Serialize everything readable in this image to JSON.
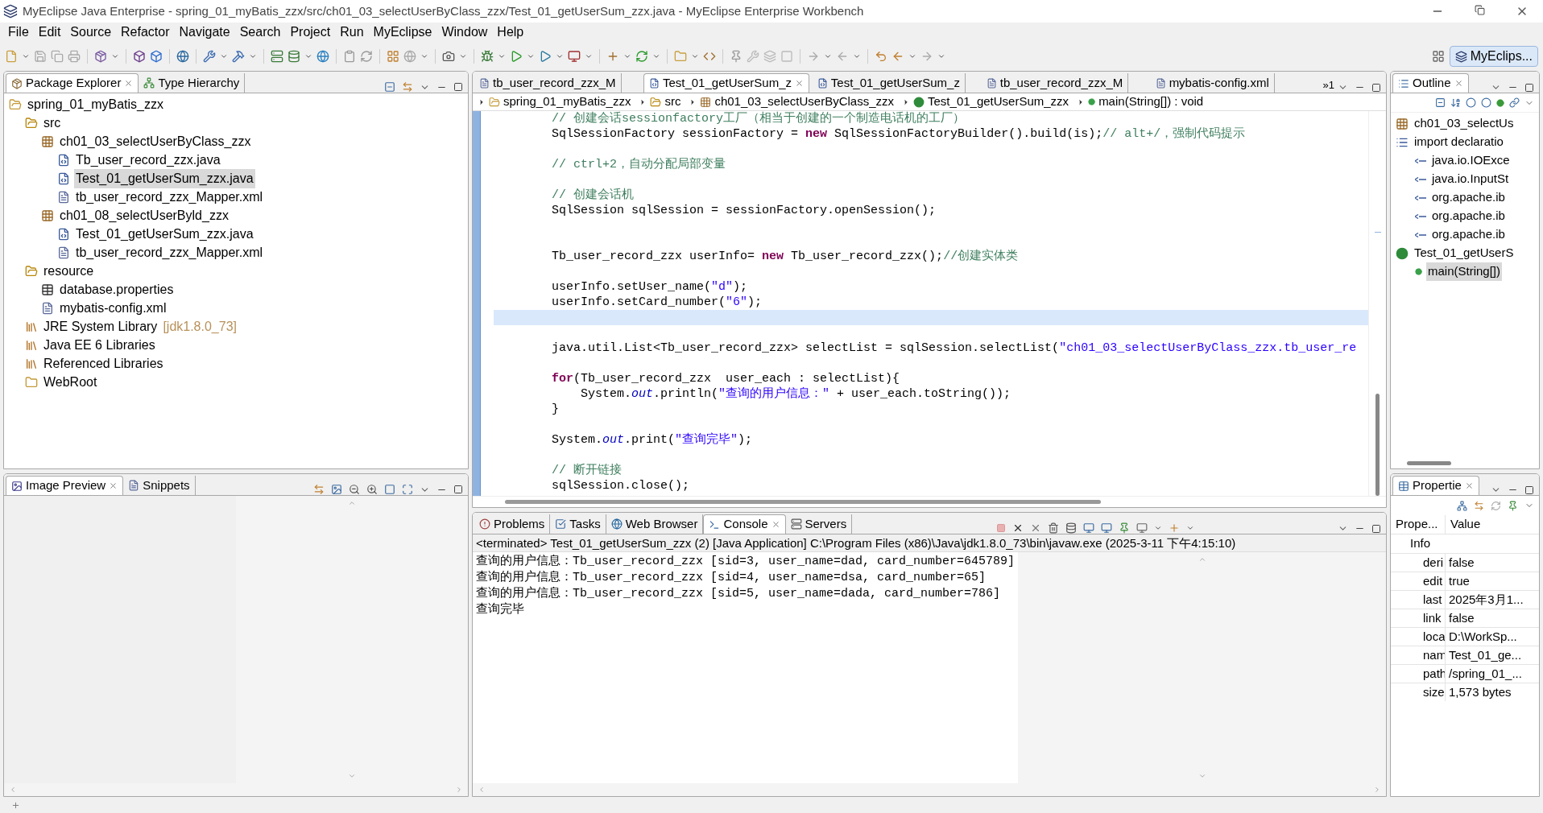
{
  "window": {
    "title": "MyEclipse Java Enterprise - spring_01_myBatis_zzx/src/ch01_03_selectUserByClass_zzx/Test_01_getUserSum_zzx.java - MyEclipse Enterprise Workbench"
  },
  "menu": [
    "File",
    "Edit",
    "Source",
    "Refactor",
    "Navigate",
    "Search",
    "Project",
    "Run",
    "MyEclipse",
    "Window",
    "Help"
  ],
  "perspective": {
    "label": "MyEclips...",
    "selected": true
  },
  "package_explorer": {
    "tabs": [
      {
        "label": "Package Explorer",
        "selected": true
      },
      {
        "label": "Type Hierarchy",
        "selected": false
      }
    ],
    "tree": [
      {
        "label": "spring_01_myBatis_zzx",
        "kind": "project",
        "selected": false,
        "children": [
          {
            "label": "src",
            "kind": "source-folder",
            "selected": false,
            "children": [
              {
                "label": "ch01_03_selectUserByClass_zzx",
                "kind": "package",
                "selected": false,
                "children": [
                  {
                    "label": "Tb_user_record_zzx.java",
                    "kind": "java",
                    "selected": false
                  },
                  {
                    "label": "Test_01_getUserSum_zzx.java",
                    "kind": "java",
                    "selected": true
                  },
                  {
                    "label": "tb_user_record_zzx_Mapper.xml",
                    "kind": "xml",
                    "selected": false
                  }
                ]
              },
              {
                "label": "ch01_08_selectUserByld_zzx",
                "kind": "package",
                "selected": false,
                "children": [
                  {
                    "label": "Test_01_getUserSum_zzx.java",
                    "kind": "java",
                    "selected": false
                  },
                  {
                    "label": "tb_user_record_zzx_Mapper.xml",
                    "kind": "xml",
                    "selected": false
                  }
                ]
              }
            ]
          },
          {
            "label": "resource",
            "kind": "source-folder",
            "selected": false,
            "children": [
              {
                "label": "database.properties",
                "kind": "properties",
                "selected": false
              },
              {
                "label": "mybatis-config.xml",
                "kind": "xml",
                "selected": false
              }
            ]
          },
          {
            "label": "JRE System Library",
            "decoration": "[jdk1.8.0_73]",
            "kind": "library",
            "selected": false
          },
          {
            "label": "Java EE 6 Libraries",
            "kind": "library",
            "selected": false
          },
          {
            "label": "Referenced Libraries",
            "kind": "library",
            "selected": false
          },
          {
            "label": "WebRoot",
            "kind": "folder",
            "selected": false
          }
        ]
      }
    ]
  },
  "image_preview": {
    "tabs": [
      {
        "label": "Image Preview",
        "selected": true
      },
      {
        "label": "Snippets",
        "selected": false
      }
    ]
  },
  "editor": {
    "tabs": [
      {
        "label": "tb_user_record_zzx_M",
        "kind": "xml",
        "selected": false
      },
      {
        "label": "Test_01_getUserSum_z",
        "kind": "java",
        "selected": true
      },
      {
        "label": "Test_01_getUserSum_z",
        "kind": "java",
        "selected": false
      },
      {
        "label": "tb_user_record_zzx_M",
        "kind": "xml",
        "selected": false
      },
      {
        "label": "mybatis-config.xml",
        "kind": "xml",
        "selected": false
      }
    ],
    "overflow": "»1",
    "breadcrumb": [
      {
        "label": "spring_01_myBatis_zzx",
        "kind": "project"
      },
      {
        "label": "src",
        "kind": "source-folder"
      },
      {
        "label": "ch01_03_selectUserByClass_zzx",
        "kind": "package"
      },
      {
        "label": "Test_01_getUserSum_zzx",
        "kind": "class"
      },
      {
        "label": "main(String[]) : void",
        "kind": "method"
      }
    ],
    "lines": [
      {
        "current": false,
        "segments": [
          {
            "kind": "comment",
            "text": "        // 创建会话sessionfactory工厂（相当于创建的一个制造电话机的工厂）"
          }
        ]
      },
      {
        "current": false,
        "segments": [
          {
            "kind": "plain",
            "text": "        SqlSessionFactory sessionFactory = "
          },
          {
            "kind": "keyword",
            "text": "new"
          },
          {
            "kind": "plain",
            "text": " SqlSessionFactoryBuilder().build(is);"
          },
          {
            "kind": "comment",
            "text": "// alt+/，强制代码提示"
          }
        ]
      },
      {
        "current": false
      },
      {
        "current": false,
        "segments": [
          {
            "kind": "comment",
            "text": "        // ctrl+2，自动分配局部变量"
          }
        ]
      },
      {
        "current": false
      },
      {
        "current": false,
        "segments": [
          {
            "kind": "comment",
            "text": "        // 创建会话机"
          }
        ]
      },
      {
        "current": false,
        "segments": [
          {
            "kind": "plain",
            "text": "        SqlSession sqlSession = sessionFactory.openSession();"
          }
        ]
      },
      {
        "current": false
      },
      {
        "current": false
      },
      {
        "current": false,
        "segments": [
          {
            "kind": "plain",
            "text": "        Tb_user_record_zzx userInfo= "
          },
          {
            "kind": "keyword",
            "text": "new"
          },
          {
            "kind": "plain",
            "text": " Tb_user_record_zzx();"
          },
          {
            "kind": "comment",
            "text": "//创建实体类"
          }
        ]
      },
      {
        "current": false
      },
      {
        "current": false,
        "segments": [
          {
            "kind": "plain",
            "text": "        userInfo.setUser_name("
          },
          {
            "kind": "string",
            "text": "\"d\""
          },
          {
            "kind": "plain",
            "text": ");"
          }
        ]
      },
      {
        "current": false,
        "segments": [
          {
            "kind": "plain",
            "text": "        userInfo.setCard_number("
          },
          {
            "kind": "string",
            "text": "\"6\""
          },
          {
            "kind": "plain",
            "text": ");"
          }
        ]
      },
      {
        "current": true
      },
      {
        "current": false
      },
      {
        "current": false,
        "segments": [
          {
            "kind": "plain",
            "text": "        java.util.List<Tb_user_record_zzx> selectList = sqlSession.selectList("
          },
          {
            "kind": "string",
            "text": "\"ch01_03_selectUserByClass_zzx.tb_user_re"
          }
        ]
      },
      {
        "current": false
      },
      {
        "current": false,
        "segments": [
          {
            "kind": "keyword",
            "text": "        for"
          },
          {
            "kind": "plain",
            "text": "(Tb_user_record_zzx  user_each : selectList){"
          }
        ]
      },
      {
        "current": false,
        "segments": [
          {
            "kind": "plain",
            "text": "            System."
          },
          {
            "kind": "static",
            "text": "out"
          },
          {
            "kind": "plain",
            "text": ".println("
          },
          {
            "kind": "string",
            "text": "\"查询的用户信息：\""
          },
          {
            "kind": "plain",
            "text": " + user_each.toString());"
          }
        ]
      },
      {
        "current": false,
        "segments": [
          {
            "kind": "plain",
            "text": "        }"
          }
        ]
      },
      {
        "current": false
      },
      {
        "current": false,
        "segments": [
          {
            "kind": "plain",
            "text": "        System."
          },
          {
            "kind": "static",
            "text": "out"
          },
          {
            "kind": "plain",
            "text": ".print("
          },
          {
            "kind": "string",
            "text": "\"查询完毕\""
          },
          {
            "kind": "plain",
            "text": ");"
          }
        ]
      },
      {
        "current": false
      },
      {
        "current": false,
        "segments": [
          {
            "kind": "comment",
            "text": "        // 断开链接"
          }
        ]
      },
      {
        "current": false,
        "segments": [
          {
            "kind": "plain",
            "text": "        sqlSession.close();"
          }
        ]
      }
    ]
  },
  "console": {
    "tabs": [
      {
        "label": "Problems",
        "selected": false
      },
      {
        "label": "Tasks",
        "selected": false
      },
      {
        "label": "Web Browser",
        "selected": false
      },
      {
        "label": "Console",
        "selected": true
      },
      {
        "label": "Servers",
        "selected": false
      }
    ],
    "header": "<terminated> Test_01_getUserSum_zzx (2) [Java Application] C:\\Program Files (x86)\\Java\\jdk1.8.0_73\\bin\\javaw.exe (2025-3-11 下午4:15:10)",
    "output": [
      "查询的用户信息：Tb_user_record_zzx [sid=3, user_name=dad, card_number=645789]",
      "查询的用户信息：Tb_user_record_zzx [sid=4, user_name=dsa, card_number=65]",
      "查询的用户信息：Tb_user_record_zzx [sid=5, user_name=dada, card_number=786]",
      "查询完毕"
    ]
  },
  "outline": {
    "tab": {
      "label": "Outline",
      "selected": true
    },
    "tree": [
      {
        "label": "ch01_03_selectUs",
        "kind": "package",
        "selected": false
      },
      {
        "label": "import declaratio",
        "kind": "imports",
        "selected": false,
        "children": [
          {
            "label": "java.io.IOExce",
            "kind": "import",
            "selected": false
          },
          {
            "label": "java.io.InputSt",
            "kind": "import",
            "selected": false
          },
          {
            "label": "org.apache.ib",
            "kind": "import",
            "selected": false
          },
          {
            "label": "org.apache.ib",
            "kind": "import",
            "selected": false
          },
          {
            "label": "org.apache.ib",
            "kind": "import",
            "selected": false
          }
        ]
      },
      {
        "label": "Test_01_getUserS",
        "kind": "class",
        "selected": false,
        "children": [
          {
            "label": "main(String[])",
            "kind": "method",
            "selected": true
          }
        ]
      }
    ]
  },
  "properties": {
    "tab": {
      "label": "Propertie",
      "selected": true
    },
    "columns": [
      "Prope...",
      "Value"
    ],
    "group": "Info",
    "rows": [
      {
        "name": "deri",
        "value": "false"
      },
      {
        "name": "edit",
        "value": "true"
      },
      {
        "name": "last",
        "value": "2025年3月1..."
      },
      {
        "name": "link",
        "value": "false"
      },
      {
        "name": "loca",
        "value": "D:\\WorkSp..."
      },
      {
        "name": "nam",
        "value": "Test_01_ge..."
      },
      {
        "name": "path",
        "value": "/spring_01_..."
      },
      {
        "name": "size",
        "value": "1,573  bytes"
      }
    ]
  }
}
